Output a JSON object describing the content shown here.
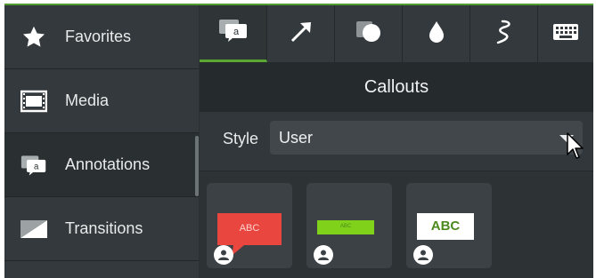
{
  "sidebar": {
    "items": [
      {
        "label": "Favorites",
        "icon": "star-icon"
      },
      {
        "label": "Media",
        "icon": "film-icon"
      },
      {
        "label": "Annotations",
        "icon": "annotation-icon",
        "active": true
      },
      {
        "label": "Transitions",
        "icon": "transition-icon"
      }
    ]
  },
  "toolbar": {
    "tabs": [
      {
        "name": "callouts-tab",
        "icon": "callout-icon",
        "active": true
      },
      {
        "name": "arrows-lines-tab",
        "icon": "arrow-icon"
      },
      {
        "name": "shapes-tab",
        "icon": "shape-icon"
      },
      {
        "name": "blur-highlight-tab",
        "icon": "drop-icon"
      },
      {
        "name": "sketch-motion-tab",
        "icon": "sketch-icon"
      },
      {
        "name": "keystroke-tab",
        "icon": "keyboard-icon"
      }
    ]
  },
  "panel": {
    "title": "Callouts",
    "style_label": "Style",
    "style_value": "User"
  },
  "tiles": [
    {
      "name": "red-callout-tile",
      "text": "ABC"
    },
    {
      "name": "green-bar-tile",
      "text": "ABC"
    },
    {
      "name": "white-box-tile",
      "text": "ABC"
    }
  ],
  "colors": {
    "accent": "#5aa832",
    "callout_red": "#e8463f",
    "callout_green": "#7fd11a",
    "text_green": "#4b8a1f"
  }
}
